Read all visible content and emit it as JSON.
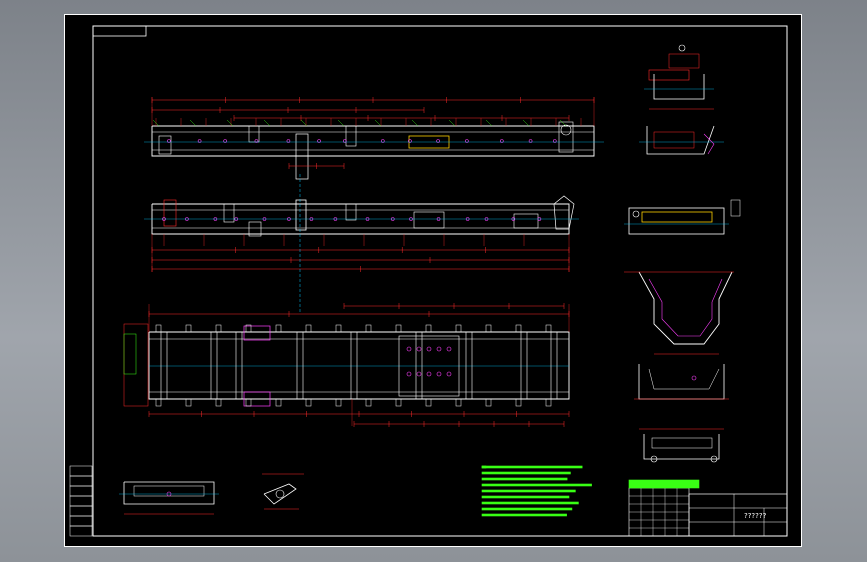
{
  "viewport": {
    "background": "#8a8f96"
  },
  "sheet": {
    "background": "#000000",
    "frame_color": "#ffffff"
  },
  "colors": {
    "dim_line": "#ff2a2a",
    "outline": "#ffffff",
    "note_text": "#39ff14",
    "center_line": "#00c8ff",
    "hatch": "#ff40ff",
    "highlight": "#ffd000"
  },
  "views": [
    {
      "id": "side-elevation"
    },
    {
      "id": "front-elevation"
    },
    {
      "id": "plan-view"
    },
    {
      "id": "section-a-a"
    },
    {
      "id": "section-b-b"
    },
    {
      "id": "section-c-c"
    },
    {
      "id": "section-d-d"
    },
    {
      "id": "section-e-e"
    },
    {
      "id": "section-f-f"
    },
    {
      "id": "detail-g"
    },
    {
      "id": "detail-h"
    }
  ],
  "title_block": {
    "drawing_title": "??????"
  }
}
